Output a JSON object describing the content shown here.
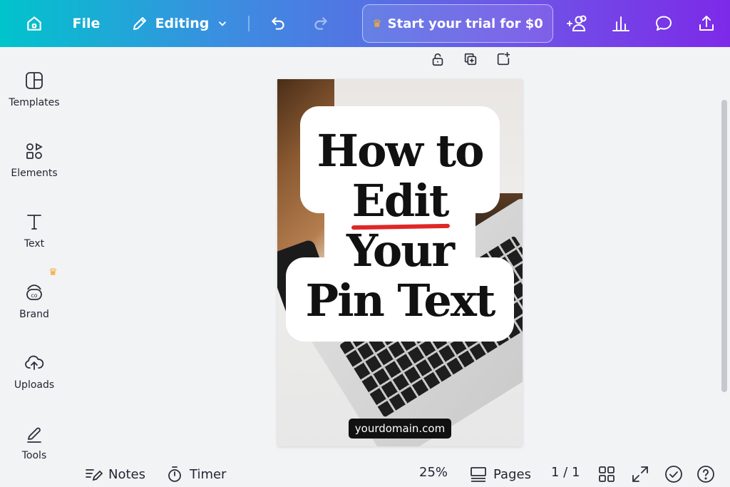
{
  "topbar": {
    "home_icon": "home-icon",
    "file_label": "File",
    "editing_label": "Editing",
    "trial_label": "Start your trial for $0",
    "gradient": [
      "#00c4cc",
      "#7d2ae8"
    ]
  },
  "sidebar": {
    "items": [
      {
        "label": "Templates",
        "icon": "templates-icon"
      },
      {
        "label": "Elements",
        "icon": "elements-icon"
      },
      {
        "label": "Text",
        "icon": "text-icon"
      },
      {
        "label": "Brand",
        "icon": "brand-icon"
      },
      {
        "label": "Uploads",
        "icon": "uploads-icon"
      },
      {
        "label": "Tools",
        "icon": "tools-icon"
      }
    ]
  },
  "design": {
    "line1": "How to",
    "line2": "Edit",
    "line3": "Your",
    "line4": "Pin Text",
    "domain": "yourdomain.com",
    "underline_color": "#e02727"
  },
  "bottom": {
    "notes_label": "Notes",
    "timer_label": "Timer",
    "zoom": "25%",
    "pages_label": "Pages",
    "page_count": "1 / 1"
  }
}
